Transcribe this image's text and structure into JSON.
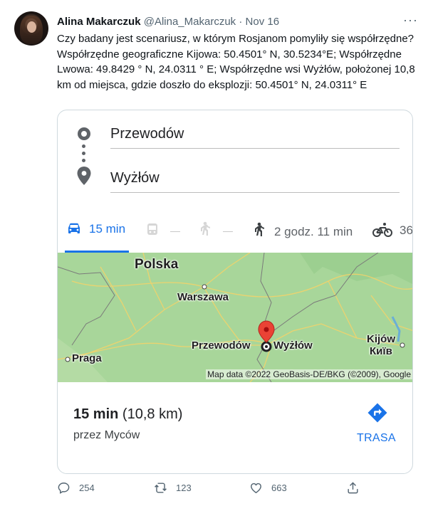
{
  "author": {
    "name": "Alina Makarczuk",
    "handle": "@Alina_Makarczuk",
    "separator": "·",
    "date": "Nov 16"
  },
  "more_label": "···",
  "tweet_text": "Czy badany jest scenariusz, w którym Rosjanom pomyliły się współrzędne? Współrzędne geograficzne Kijowa: 50.4501° N, 30.5234°E; Współrzędne Lwowa: 49.8429 ° N, 24.0311 ° E; Współrzędne wsi Wyżłów, położonej 10,8 km od miejsca, gdzie doszło do eksplozji: 50.4501° N, 24.0311° E",
  "card": {
    "origin": "Przewodów",
    "destination": "Wyżłów",
    "modes": {
      "car": "15 min",
      "walk": "2 godz. 11 min",
      "bike": "36"
    },
    "map": {
      "labels": {
        "poland": "Polska",
        "warsaw": "Warszawa",
        "prague": "Praga",
        "przewodow": "Przewodów",
        "wyzlow": "Wyżłów",
        "kyiv_latin": "Kijów",
        "kyiv_cyrillic": "Київ"
      },
      "attribution": "Map data ©2022 GeoBasis-DE/BKG (©2009), Google"
    },
    "duration_bold": "15 min",
    "distance": "(10,8 km)",
    "via": "przez Myców",
    "directions_label": "TRASA",
    "colors": {
      "accent": "#1a73e8",
      "map_land": "#a8d69a",
      "pin": "#ea4335"
    }
  },
  "stats": {
    "replies": "254",
    "retweets": "123",
    "likes": "663"
  }
}
